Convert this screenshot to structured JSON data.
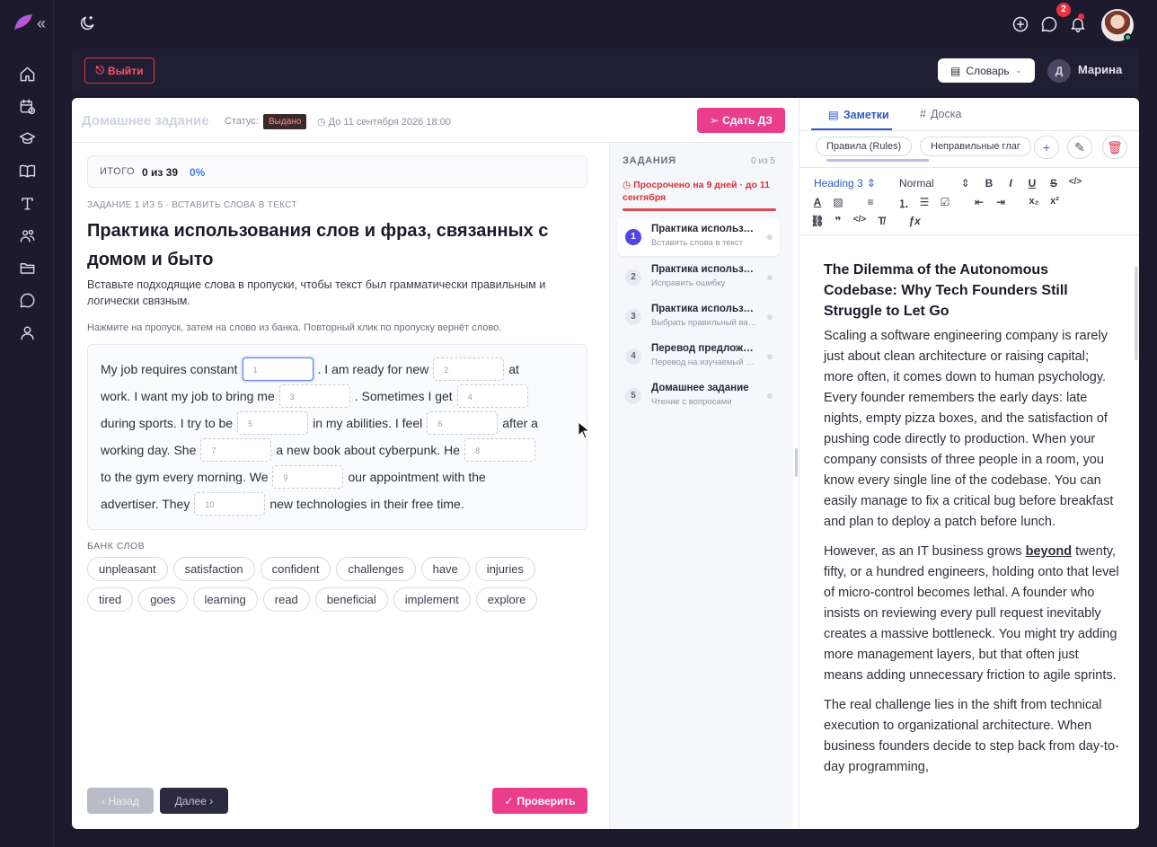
{
  "topbar": {
    "notification_count": "2"
  },
  "subbar": {
    "logout_label": "Выйти",
    "dictionary_label": "Словарь",
    "user_initial": "Д",
    "user_name": "Марина"
  },
  "homework": {
    "title": "Домашнее задание",
    "status_label": "Статус:",
    "status_value": "Выдано",
    "due": "До 11 сентября 2026 18:00",
    "submit_label": "Сдать ДЗ"
  },
  "total": {
    "label": "ИТОГО",
    "count": "0 из 39",
    "percent": "0%"
  },
  "task": {
    "meta": "ЗАДАНИЕ 1 ИЗ 5 · ВСТАВИТЬ СЛОВА В ТЕКСТ",
    "title": "Практика использования слов и фраз, связанных с домом и быто",
    "description": "Вставьте подходящие слова в пропуски, чтобы текст был грамматически правильным и логически связным.",
    "hint": "Нажмите на пропуск, затем на слово из банка. Повторный клик по пропуску вернёт слово."
  },
  "exercise": {
    "l1a": "My job requires constant",
    "b1": "1",
    "l1b": ". I am ready for new",
    "b2": "2",
    "l1c": "at",
    "l2a": "work. I want my job to bring me",
    "b3": "3",
    "l2b": ". Sometimes I get",
    "b4": "4",
    "l3a": "during sports. I try to be",
    "b5": "5",
    "l3b": "in my abilities. I feel",
    "b6": "6",
    "l3c": "after a",
    "l4a": "working day. She",
    "b7": "7",
    "l4b": "a new book about cyberpunk. He",
    "b8": "8",
    "l5a": "to the gym every morning. We",
    "b9": "9",
    "l5b": "our appointment with the",
    "l6a": "advertiser. They",
    "b10": "10",
    "l6b": "new technologies in their free time."
  },
  "word_bank": {
    "label": "БАНК СЛОВ",
    "row1": [
      "unpleasant",
      "satisfaction",
      "confident",
      "challenges",
      "have",
      "injuries"
    ],
    "row2": [
      "tired",
      "goes",
      "learning",
      "read",
      "beneficial",
      "implement",
      "explore"
    ]
  },
  "footer": {
    "back_label": "‹ Назад",
    "next_label": "Далее ›",
    "check_label": "Проверить"
  },
  "tasks_panel": {
    "heading": "ЗАДАНИЯ",
    "count": "0 из 5",
    "overdue": "Просрочено на 9 дней · до 11 сентября",
    "items": [
      {
        "num": "1",
        "title": "Практика использования слов",
        "subtitle": "Вставить слова в текст"
      },
      {
        "num": "2",
        "title": "Практика использования слов",
        "subtitle": "Исправить ошибку"
      },
      {
        "num": "3",
        "title": "Практика использования слов",
        "subtitle": "Выбрать правильный вариант"
      },
      {
        "num": "4",
        "title": "Перевод предложений",
        "subtitle": "Перевод на изучаемый язык"
      },
      {
        "num": "5",
        "title": "Домашнее задание",
        "subtitle": "Чтение с вопросами"
      }
    ]
  },
  "notes": {
    "tab_notes": "Заметки",
    "tab_board": "Доска",
    "pill1": "Правила (Rules)",
    "pill2": "Неправильные глаг",
    "heading_select": "Heading 3",
    "size_select": "Normal",
    "doc_title": "The Dilemma of the Autonomous Codebase: Why Tech Founders Still Struggle to Let Go",
    "p1": "Scaling a software engineering company is rarely just about clean architecture or raising capital; more often, it comes down to human psychology. Every founder remembers the early days: late nights, empty pizza boxes, and the satisfaction of pushing code directly to production. When your company consists of three people in a room, you know every single line of the codebase. You can easily manage to fix a critical bug before breakfast and plan to deploy a patch before lunch.",
    "p2_start": "However, as an IT business grows ",
    "p2_bold": "beyond",
    "p2_end": " twenty, fifty, or a hundred engineers, holding onto that level of micro-control becomes lethal. A founder who insists on reviewing every pull request inevitably creates a massive bottleneck. You might try adding more management layers, but that often just means adding unnecessary friction to agile sprints.",
    "p3": "The real challenge lies in the shift from technical execution to organizational architecture. When business founders decide to step back from day-to-day programming,"
  }
}
